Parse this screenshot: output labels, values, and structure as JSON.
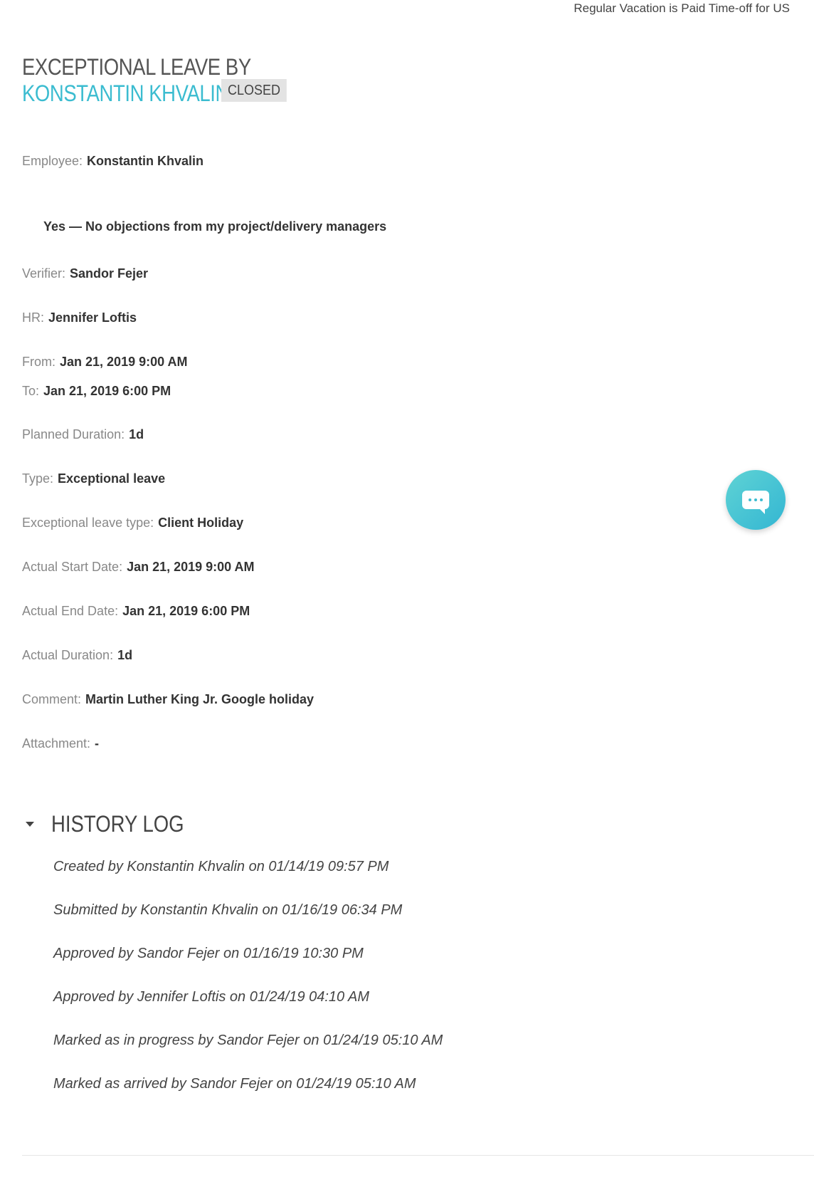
{
  "top_note": "Regular Vacation is Paid Time-off for US",
  "header": {
    "title_prefix": "EXCEPTIONAL LEAVE BY",
    "employee_name": "KONSTANTIN KHVALIN",
    "status": "CLOSED"
  },
  "fields": {
    "employee": {
      "label": "Employee:",
      "value": "Konstantin Khvalin"
    },
    "objections": "Yes — No objections from my project/delivery managers",
    "verifier": {
      "label": "Verifier:",
      "value": "Sandor Fejer"
    },
    "hr": {
      "label": "HR:",
      "value": "Jennifer Loftis"
    },
    "from": {
      "label": "From:",
      "value": "Jan 21, 2019 9:00 AM"
    },
    "to": {
      "label": "To:",
      "value": "Jan 21, 2019 6:00 PM"
    },
    "planned_duration": {
      "label": "Planned Duration:",
      "value": "1d"
    },
    "type": {
      "label": "Type:",
      "value": "Exceptional leave"
    },
    "exceptional_leave_type": {
      "label": "Exceptional leave type:",
      "value": "Client Holiday"
    },
    "actual_start": {
      "label": "Actual Start Date:",
      "value": "Jan 21, 2019 9:00 AM"
    },
    "actual_end": {
      "label": "Actual End Date:",
      "value": "Jan 21, 2019 6:00 PM"
    },
    "actual_duration": {
      "label": "Actual Duration:",
      "value": "1d"
    },
    "comment": {
      "label": "Comment:",
      "value": "Martin Luther King Jr. Google holiday"
    },
    "attachment": {
      "label": "Attachment:",
      "value": "-"
    }
  },
  "history": {
    "title": "HISTORY LOG",
    "entries": [
      "Created by Konstantin Khvalin on 01/14/19 09:57 PM",
      "Submitted by Konstantin Khvalin on 01/16/19 06:34 PM",
      "Approved by Sandor Fejer on 01/16/19 10:30 PM",
      "Approved by Jennifer Loftis on 01/24/19 04:10 AM",
      "Marked as in progress by Sandor Fejer on 01/24/19 05:10 AM",
      "Marked as arrived by Sandor Fejer on 01/24/19 05:10 AM"
    ]
  },
  "chat_icon": "chat-bubble-icon",
  "accent_color": "#3bbcd0"
}
